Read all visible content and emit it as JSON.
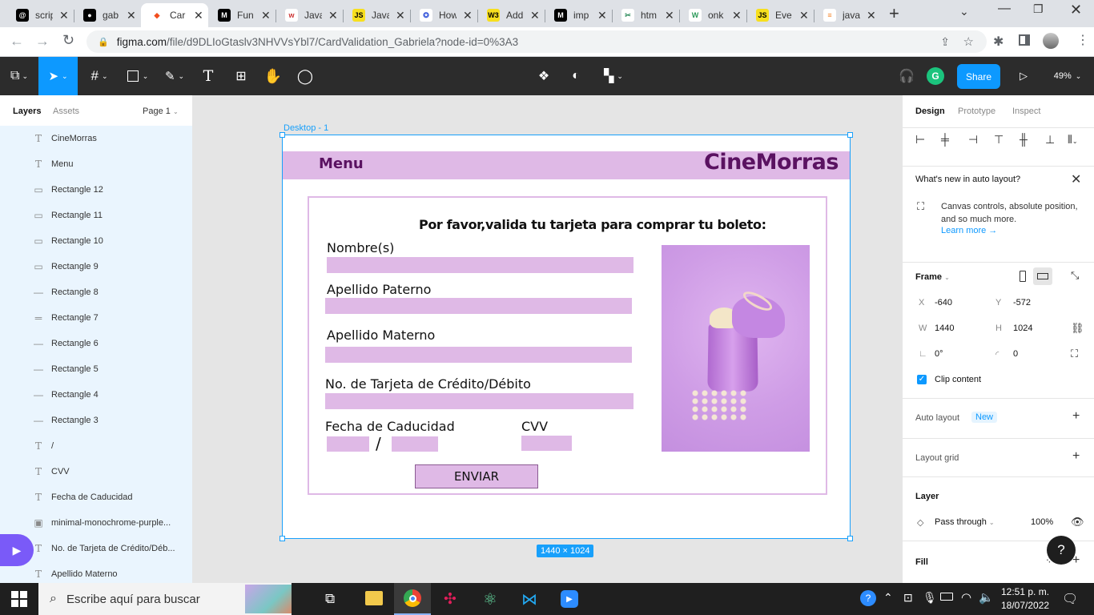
{
  "browser": {
    "tabs": [
      {
        "title": "scrip",
        "icon": "threads-icon"
      },
      {
        "title": "gab",
        "icon": "github-icon"
      },
      {
        "title": "Car",
        "icon": "figma-icon",
        "active": true
      },
      {
        "title": "Fun",
        "icon": "medium-icon"
      },
      {
        "title": "Java",
        "icon": "w3r-icon"
      },
      {
        "title": "Java",
        "icon": "js-icon"
      },
      {
        "title": "How",
        "icon": "star-icon"
      },
      {
        "title": "Add",
        "icon": "w3-icon"
      },
      {
        "title": "imp",
        "icon": "medium-icon"
      },
      {
        "title": "htm",
        "icon": "tool-icon"
      },
      {
        "title": "onk",
        "icon": "w-icon"
      },
      {
        "title": "Eve",
        "icon": "js-icon"
      },
      {
        "title": "java",
        "icon": "stackoverflow-icon"
      }
    ],
    "url_host": "figma.com",
    "url_path": "/file/d9DLIoGtaslv3NHVVsYbl7/CardValidation_Gabriela?node-id=0%3A3"
  },
  "toolbar": {
    "share_label": "Share",
    "zoom": "49%",
    "avatar_letter": "G"
  },
  "left_panel": {
    "tabs": [
      "Layers",
      "Assets"
    ],
    "page": "Page 1",
    "layers": [
      {
        "icon": "T",
        "label": "CineMorras"
      },
      {
        "icon": "T",
        "label": "Menu"
      },
      {
        "icon": "▭",
        "label": "Rectangle 12"
      },
      {
        "icon": "▭",
        "label": "Rectangle 11"
      },
      {
        "icon": "▭",
        "label": "Rectangle 10"
      },
      {
        "icon": "▭",
        "label": "Rectangle 9"
      },
      {
        "icon": "—",
        "label": "Rectangle 8"
      },
      {
        "icon": "═",
        "label": "Rectangle 7"
      },
      {
        "icon": "—",
        "label": "Rectangle 6"
      },
      {
        "icon": "—",
        "label": "Rectangle 5"
      },
      {
        "icon": "—",
        "label": "Rectangle 4"
      },
      {
        "icon": "—",
        "label": "Rectangle 3"
      },
      {
        "icon": "T",
        "label": "/"
      },
      {
        "icon": "T",
        "label": "CVV"
      },
      {
        "icon": "T",
        "label": "Fecha de Caducidad"
      },
      {
        "icon": "▣",
        "label": "minimal-monochrome-purple..."
      },
      {
        "icon": "T",
        "label": "No. de Tarjeta de Crédito/Déb..."
      },
      {
        "icon": "T",
        "label": "Apellido Materno"
      }
    ]
  },
  "canvas": {
    "frame_name": "Desktop - 1",
    "size_badge": "1440 × 1024",
    "design": {
      "menu": "Menu",
      "brand": "CineMorras",
      "heading": "Por favor,valida tu tarjeta para comprar tu boleto:",
      "nombre": "Nombre(s)",
      "paterno": "Apellido Paterno",
      "materno": "Apellido Materno",
      "tarjeta": "No. de Tarjeta de Crédito/Débito",
      "caducidad": "Fecha de Caducidad",
      "slash": "/",
      "cvv": "CVV",
      "enviar": "ENVIAR"
    }
  },
  "right_panel": {
    "tabs": [
      "Design",
      "Prototype",
      "Inspect"
    ],
    "whats_new_title": "What's new in auto layout?",
    "whats_new_body": "Canvas controls, absolute position, and so much more.",
    "learn_more": "Learn more →",
    "frame_label": "Frame",
    "x_label": "X",
    "x_value": "-640",
    "y_label": "Y",
    "y_value": "-572",
    "w_label": "W",
    "w_value": "1440",
    "h_label": "H",
    "h_value": "1024",
    "rotation": "0°",
    "radius": "0",
    "clip_content": "Clip content",
    "auto_layout": "Auto layout",
    "new_badge": "New",
    "layout_grid": "Layout grid",
    "layer": "Layer",
    "blend": "Pass through",
    "opacity": "100%",
    "fill": "Fill",
    "help": "?"
  },
  "taskbar": {
    "search_placeholder": "Escribe aquí para buscar",
    "time": "12:51 p. m.",
    "date": "18/07/2022"
  },
  "colors": {
    "accent": "#18a0fb",
    "figma_dark": "#2c2c2c",
    "design_purple": "#dfb9e6",
    "brand_text": "#5a1261"
  }
}
